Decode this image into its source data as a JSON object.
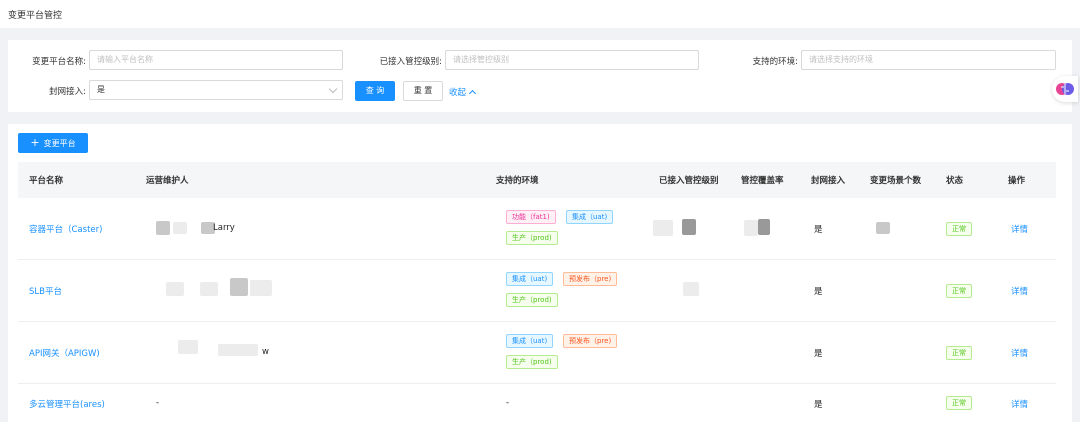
{
  "page": {
    "title": "变更平台管控"
  },
  "filters": {
    "platform_name": {
      "label": "变更平台名称:",
      "placeholder": "请输入平台名称"
    },
    "control_level": {
      "label": "已接入管控级别:",
      "placeholder": "请选择管控级别"
    },
    "environment": {
      "label": "支持的环境:",
      "placeholder": "请选择支持的环境"
    },
    "network_access": {
      "label": "封网接入:",
      "value": "是"
    },
    "query_label": "查 询",
    "reset_label": "重 置",
    "collapse_label": "收起"
  },
  "toolbar": {
    "add_label": "变更平台"
  },
  "table": {
    "headers": [
      "平台名称",
      "运营维护人",
      "支持的环境",
      "已接入管控级别",
      "管控覆盖率",
      "封网接入",
      "变更场景个数",
      "状态",
      "操作"
    ],
    "rows": [
      {
        "name": "容器平台（Caster)",
        "maintainer": "Larry",
        "envs": [
          "功能（fat1)",
          "集成（uat)",
          "生产（prod)"
        ],
        "network": "是",
        "status": "正常",
        "action": "详情"
      },
      {
        "name": "SLB平台",
        "maintainer": "",
        "envs": [
          "集成（uat)",
          "预发布（pre)",
          "生产（prod)"
        ],
        "network": "是",
        "status": "正常",
        "action": "详情"
      },
      {
        "name": "API网关（APIGW)",
        "maintainer": "w",
        "envs": [
          "集成（uat)",
          "预发布（pre)",
          "生产（prod)"
        ],
        "network": "是",
        "status": "正常",
        "action": "详情"
      },
      {
        "name": "多云管理平台(ares)",
        "maintainer": "-",
        "envs_text": "-",
        "network": "是",
        "status": "正常",
        "action": "详情"
      }
    ]
  },
  "colors": {
    "primary": "#1890ff",
    "success": "#52c41a",
    "background": "#f0f2f5"
  },
  "icons": {
    "assistant": "brain-icon",
    "add": "plus-icon"
  }
}
